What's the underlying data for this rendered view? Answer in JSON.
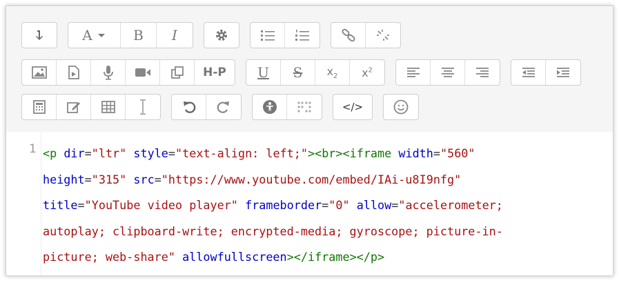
{
  "colors": {
    "tag": "#117700",
    "attribute": "#0000cc",
    "string": "#aa1111",
    "line_number": "#999999",
    "toolbar_bg": "#f5f5f5",
    "icon": "#7a7a7a"
  },
  "toolbar": {
    "font_label": "A",
    "bold_label": "B",
    "italic_label": "I",
    "h5p_label": "H-P",
    "underline_label": "U",
    "strike_label": "S",
    "subscript_base": "x",
    "subscript_index": "2",
    "superscript_base": "x",
    "superscript_index": "2",
    "html_label": "</>",
    "icons": [
      "collapse-icon",
      "font-dropdown-icon",
      "bold-icon",
      "italic-icon",
      "gear-icon",
      "unordered-list-icon",
      "ordered-list-icon",
      "link-icon",
      "unlink-icon",
      "image-icon",
      "media-file-icon",
      "microphone-icon",
      "video-camera-icon",
      "manage-files-icon",
      "h5p-icon",
      "underline-icon",
      "strikethrough-icon",
      "subscript-icon",
      "superscript-icon",
      "align-left-icon",
      "align-center-icon",
      "align-right-icon",
      "outdent-icon",
      "indent-icon",
      "calculator-icon",
      "edit-icon",
      "table-icon",
      "text-cursor-icon",
      "undo-icon",
      "redo-icon",
      "accessibility-icon",
      "braille-icon",
      "html-icon",
      "emoji-icon"
    ]
  },
  "code": {
    "line_number": "1",
    "lines": [
      [
        {
          "t": "tag",
          "v": "<p"
        },
        {
          "t": "plain",
          "v": " "
        },
        {
          "t": "attr",
          "v": "dir"
        },
        {
          "t": "plain",
          "v": "="
        },
        {
          "t": "str",
          "v": "\"ltr\""
        },
        {
          "t": "plain",
          "v": " "
        },
        {
          "t": "attr",
          "v": "style"
        },
        {
          "t": "plain",
          "v": "="
        },
        {
          "t": "str",
          "v": "\"text-align: left;\""
        },
        {
          "t": "tag",
          "v": "><br><iframe"
        },
        {
          "t": "plain",
          "v": " "
        },
        {
          "t": "attr",
          "v": "width"
        },
        {
          "t": "plain",
          "v": "="
        },
        {
          "t": "str",
          "v": "\"560\""
        }
      ],
      [
        {
          "t": "attr",
          "v": "height"
        },
        {
          "t": "plain",
          "v": "="
        },
        {
          "t": "str",
          "v": "\"315\""
        },
        {
          "t": "plain",
          "v": " "
        },
        {
          "t": "attr",
          "v": "src"
        },
        {
          "t": "plain",
          "v": "="
        },
        {
          "t": "str",
          "v": "\"https://www.youtube.com/embed/IAi-u8I9nfg\""
        }
      ],
      [
        {
          "t": "attr",
          "v": "title"
        },
        {
          "t": "plain",
          "v": "="
        },
        {
          "t": "str",
          "v": "\"YouTube video player\""
        },
        {
          "t": "plain",
          "v": " "
        },
        {
          "t": "attr",
          "v": "frameborder"
        },
        {
          "t": "plain",
          "v": "="
        },
        {
          "t": "str",
          "v": "\"0\""
        },
        {
          "t": "plain",
          "v": " "
        },
        {
          "t": "attr",
          "v": "allow"
        },
        {
          "t": "plain",
          "v": "="
        },
        {
          "t": "str",
          "v": "\"accelerometer;"
        }
      ],
      [
        {
          "t": "str",
          "v": "autoplay; clipboard-write; encrypted-media; gyroscope; picture-in-"
        }
      ],
      [
        {
          "t": "str",
          "v": "picture; web-share\""
        },
        {
          "t": "plain",
          "v": " "
        },
        {
          "t": "attr",
          "v": "allowfullscreen"
        },
        {
          "t": "tag",
          "v": "></iframe></p>"
        }
      ]
    ]
  }
}
